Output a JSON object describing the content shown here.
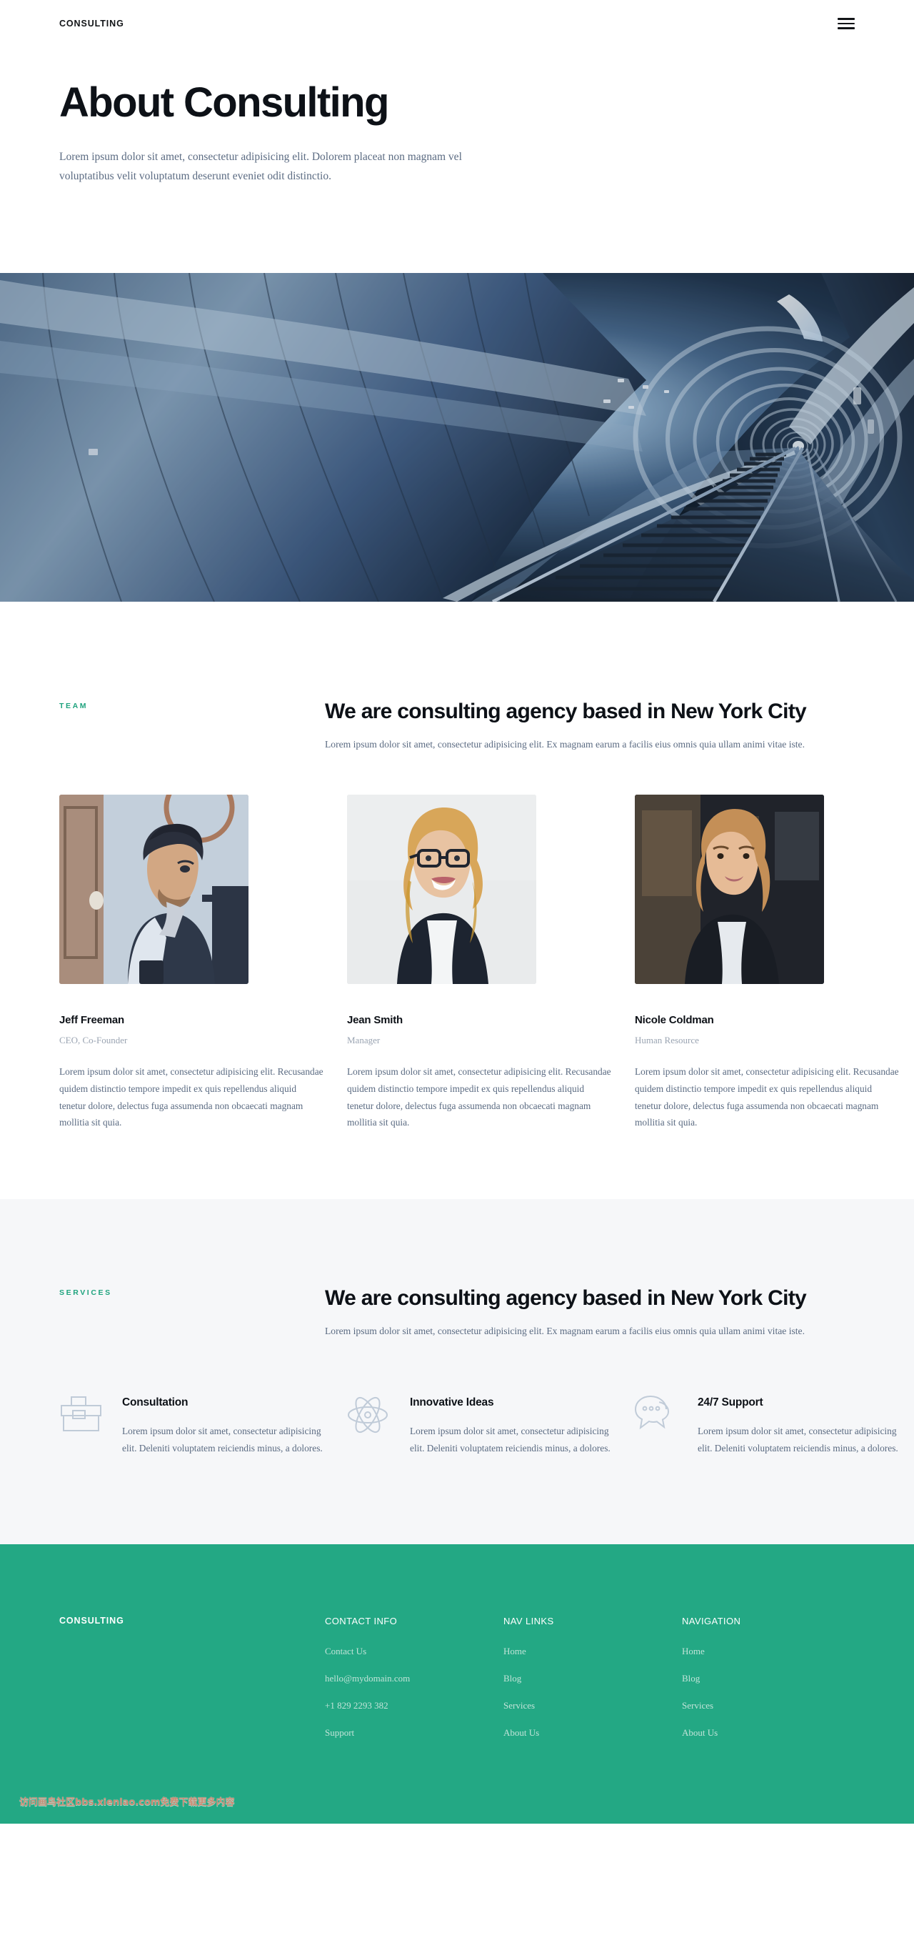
{
  "theme": {
    "accent_teal": "#1fa37e",
    "footer_bg": "#23a884",
    "heading_dark": "#0d1117",
    "body_text": "#5b6b82",
    "muted_text": "#9aa4b2",
    "alt_section_bg": "#f6f7f9"
  },
  "nav": {
    "brand": "CONSULTING",
    "menu_icon": "hamburger-icon"
  },
  "hero": {
    "title": "About Consulting",
    "subtitle": "Lorem ipsum dolor sit amet, consectetur adipisicing elit. Dolorem placeat non magnam vel voluptatibus velit voluptatum deserunt eveniet odit distinctio."
  },
  "banner": {
    "alt": "subway-tunnel-railway-tracks-photo"
  },
  "team_section": {
    "eyebrow": "TEAM",
    "heading": "We are consulting agency based in New York City",
    "description": "Lorem ipsum dolor sit amet, consectetur adipisicing elit. Ex magnam earum a facilis eius omnis quia ullam animi vitae iste.",
    "members": [
      {
        "name": "Jeff Freeman",
        "role": "CEO, Co-Founder",
        "bio": "Lorem ipsum dolor sit amet, consectetur adipisicing elit. Recusandae quidem distinctio tempore impedit ex quis repellendus aliquid tenetur dolore, delectus fuga assumenda non obcaecati magnam mollitia sit quia.",
        "photo_alt": "portrait-bearded-man"
      },
      {
        "name": "Jean Smith",
        "role": "Manager",
        "bio": "Lorem ipsum dolor sit amet, consectetur adipisicing elit. Recusandae quidem distinctio tempore impedit ex quis repellendus aliquid tenetur dolore, delectus fuga assumenda non obcaecati magnam mollitia sit quia.",
        "photo_alt": "portrait-blonde-woman-glasses"
      },
      {
        "name": "Nicole Coldman",
        "role": "Human Resource",
        "bio": "Lorem ipsum dolor sit amet, consectetur adipisicing elit. Recusandae quidem distinctio tempore impedit ex quis repellendus aliquid tenetur dolore, delectus fuga assumenda non obcaecati magnam mollitia sit quia.",
        "photo_alt": "portrait-woman-dark-blazer"
      }
    ]
  },
  "services_section": {
    "eyebrow": "SERVICES",
    "heading": "We are consulting agency based in New York City",
    "description": "Lorem ipsum dolor sit amet, consectetur adipisicing elit. Ex magnam earum a facilis eius omnis quia ullam animi vitae iste.",
    "items": [
      {
        "icon": "toolbox-icon",
        "title": "Consultation",
        "text": "Lorem ipsum dolor sit amet, consectetur adipisicing elit. Deleniti voluptatem reiciendis minus, a dolores."
      },
      {
        "icon": "atom-icon",
        "title": "Innovative Ideas",
        "text": "Lorem ipsum dolor sit amet, consectetur adipisicing elit. Deleniti voluptatem reiciendis minus, a dolores."
      },
      {
        "icon": "chat-bubbles-icon",
        "title": "24/7 Support",
        "text": "Lorem ipsum dolor sit amet, consectetur adipisicing elit. Deleniti voluptatem reiciendis minus, a dolores."
      }
    ]
  },
  "footer": {
    "brand": "CONSULTING",
    "columns": [
      {
        "title": "CONTACT INFO",
        "links": [
          "Contact Us",
          "hello@mydomain.com",
          "+1 829 2293 382",
          "Support"
        ]
      },
      {
        "title": "NAV LINKS",
        "links": [
          "Home",
          "Blog",
          "Services",
          "About Us"
        ]
      },
      {
        "title": "NAVIGATION",
        "links": [
          "Home",
          "Blog",
          "Services",
          "About Us"
        ]
      }
    ],
    "watermark": "访问画鸟社区bbs.xienlao.com免费下载更多内容"
  }
}
